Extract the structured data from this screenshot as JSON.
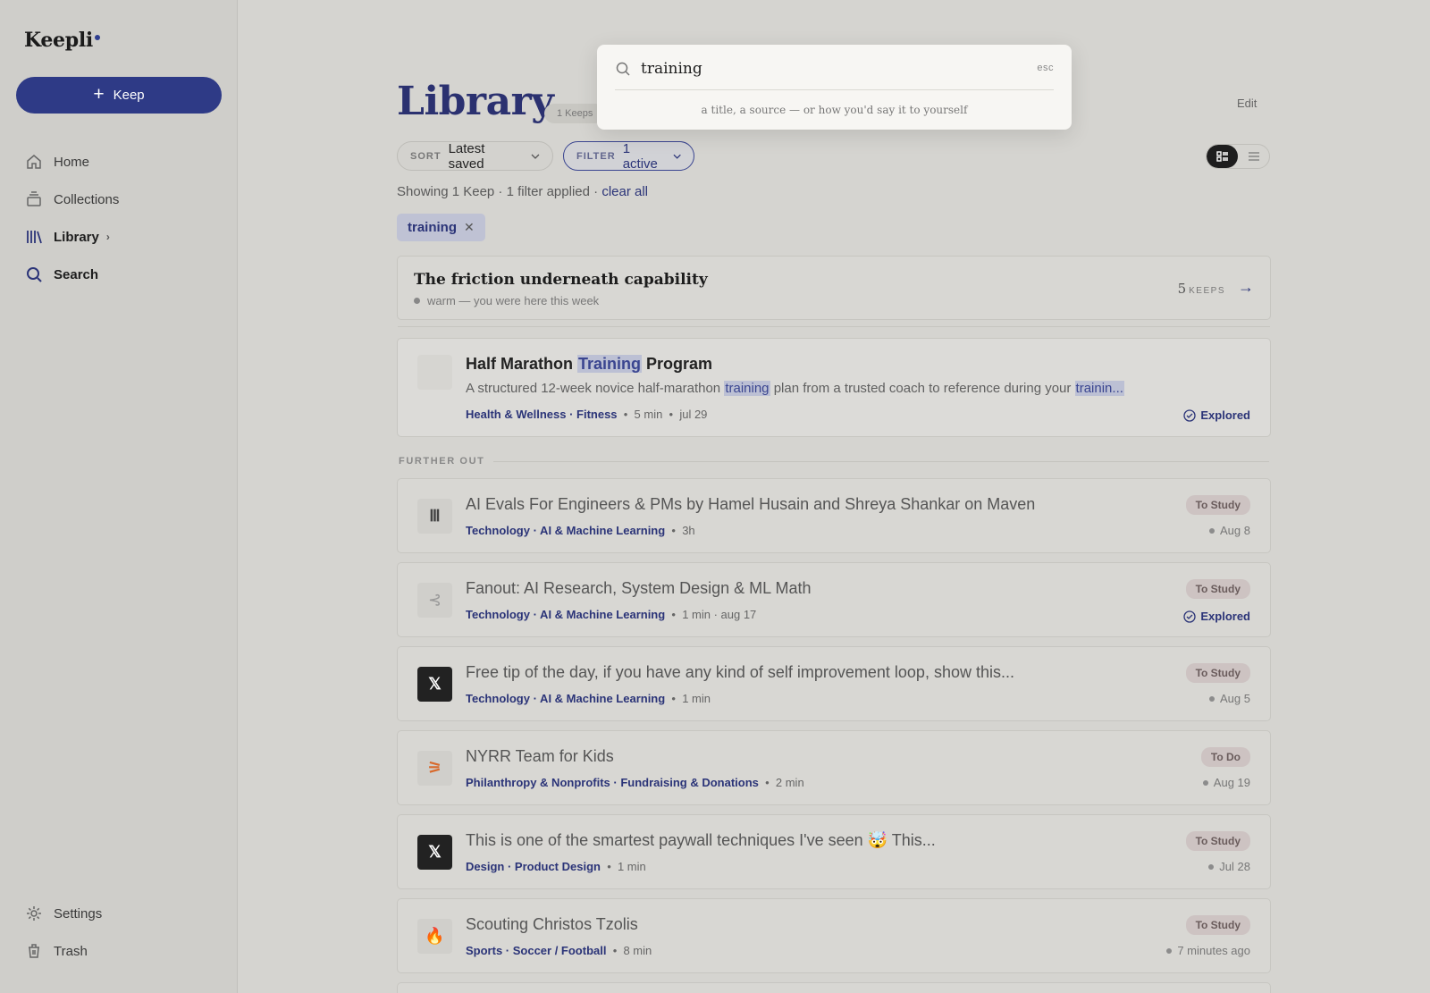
{
  "app": {
    "name": "Keepli"
  },
  "sidebar": {
    "keep_button": "Keep",
    "items": [
      {
        "label": "Home",
        "icon": "home-icon"
      },
      {
        "label": "Collections",
        "icon": "collections-icon"
      },
      {
        "label": "Library",
        "icon": "library-icon"
      },
      {
        "label": "Search",
        "icon": "search-icon"
      }
    ],
    "bottom": [
      {
        "label": "Settings",
        "icon": "gear-icon"
      },
      {
        "label": "Trash",
        "icon": "trash-icon"
      }
    ]
  },
  "header": {
    "title": "Library",
    "count": "1 Keeps",
    "edit": "Edit"
  },
  "toolbar": {
    "sort_label": "SORT",
    "sort_value": "Latest saved",
    "filter_label": "FILTER",
    "filter_value": "1 active"
  },
  "status": {
    "showing": "Showing 1 Keep · 1 filter applied · ",
    "clear": "clear all"
  },
  "active_tag": "training",
  "collection": {
    "title": "The friction underneath capability",
    "subtitle": "warm — you were here this week",
    "count": "5",
    "count_label": "KEEPS"
  },
  "result": {
    "title_pre": "Half Marathon ",
    "title_hl": "Training",
    "title_post": " Program",
    "desc_1": "A structured 12-week novice half-marathon ",
    "desc_hl1": "training",
    "desc_2": " plan from a trusted coach to reference during your ",
    "desc_hl2": "trainin...",
    "category": "Health & Wellness · Fitness",
    "duration": "5 min",
    "date": "jul 29",
    "status": "Explored"
  },
  "further_label": "FURTHER OUT",
  "items": [
    {
      "title": "AI Evals For Engineers & PMs by Hamel Husain and Shreya Shankar on Maven",
      "category": "Technology · AI & Machine Learning",
      "duration": "3h",
      "badge": "To Study",
      "date": "Aug 8",
      "thumb": "Ⅲ"
    },
    {
      "title": "Fanout: AI Research, System Design & ML Math",
      "category": "Technology · AI & Machine Learning",
      "duration": "1 min · aug 17",
      "badge": "To Study",
      "status": "Explored",
      "thumb": "⊰"
    },
    {
      "title": "Free tip of the day, if you have any kind of self improvement loop, show this...",
      "category": "Technology · AI & Machine Learning",
      "duration": "1 min",
      "badge": "To Study",
      "date": "Aug 5",
      "thumb": "𝕏"
    },
    {
      "title": "NYRR Team for Kids",
      "category": "Philanthropy & Nonprofits · Fundraising & Donations",
      "duration": "2 min",
      "badge": "To Do",
      "date": "Aug 19",
      "thumb": "⚞"
    },
    {
      "title": "This is one of the smartest paywall techniques I've seen 🤯 This...",
      "category": "Design · Product Design",
      "duration": "1 min",
      "badge": "To Study",
      "date": "Jul 28",
      "thumb": "𝕏"
    },
    {
      "title": "Scouting Christos Tzolis",
      "category": "Sports · Soccer / Football",
      "duration": "8 min",
      "badge": "To Study",
      "date": "7 minutes ago",
      "thumb": "🔥"
    }
  ],
  "search": {
    "value": "training",
    "esc": "esc",
    "hint": "a title, a source — or how you'd say it to yourself"
  },
  "colors": {
    "accent": "#2e3a86",
    "background": "#d5d4d0"
  }
}
